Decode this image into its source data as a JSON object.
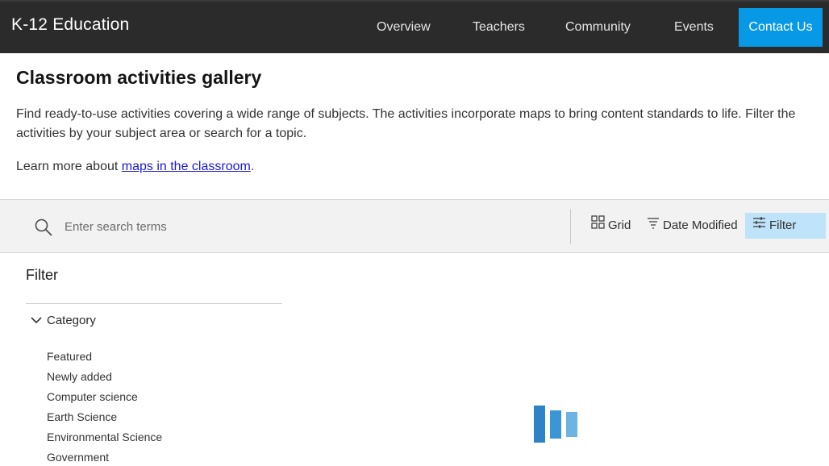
{
  "header": {
    "brand": "K-12 Education",
    "nav": [
      "Overview",
      "Teachers",
      "Community",
      "Events"
    ],
    "contact_label": "Contact Us",
    "accent_color": "#0799e5"
  },
  "intro": {
    "title": "Classroom activities gallery",
    "description": "Find ready-to-use activities covering a wide range of subjects. The activities incorporate maps to bring content standards to life. Filter the activities by your subject area or search for a topic.",
    "learn_prefix": "Learn more about ",
    "learn_link": "maps in the classroom",
    "learn_suffix": "."
  },
  "toolbar": {
    "search_placeholder": "Enter search terms",
    "grid_label": "Grid",
    "sort_label": "Date Modified",
    "filter_label": "Filter",
    "filter_active_color": "#bfe3f9"
  },
  "filter_panel": {
    "heading": "Filter",
    "category_label": "Category",
    "categories": [
      "Featured",
      "Newly added",
      "Computer science",
      "Earth Science",
      "Environmental Science",
      "Government"
    ]
  },
  "icons": {
    "search": "search-icon",
    "grid": "grid-icon",
    "sort": "sort-icon",
    "filter": "filter-icon",
    "chevron": "chevron-down-icon",
    "loader": "loading-icon"
  }
}
